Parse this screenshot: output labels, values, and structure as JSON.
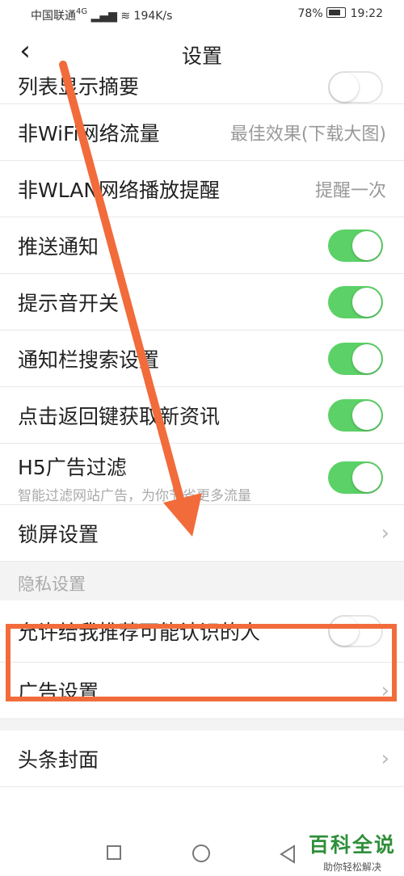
{
  "status_bar": {
    "carrier": "中国联通",
    "signal_type": "4G",
    "speed": "194K/s",
    "battery": "78%",
    "time": "19:22"
  },
  "header": {
    "back_icon": "chevron-left-icon",
    "title": "设置"
  },
  "settings": [
    {
      "label": "列表显示摘要",
      "type": "toggle",
      "on": false
    },
    {
      "label": "非WiFi网络流量",
      "type": "value",
      "value": "最佳效果(下载大图)"
    },
    {
      "label": "非WLAN网络播放提醒",
      "type": "value",
      "value": "提醒一次"
    },
    {
      "label": "推送通知",
      "type": "toggle",
      "on": true
    },
    {
      "label": "提示音开关",
      "type": "toggle",
      "on": true
    },
    {
      "label": "通知栏搜索设置",
      "type": "toggle",
      "on": true
    },
    {
      "label": "点击返回键获取新资讯",
      "type": "toggle",
      "on": true
    },
    {
      "label": "H5广告过滤",
      "sub": "智能过滤网站广告，为你节省更多流量",
      "type": "toggle",
      "on": true
    },
    {
      "label": "锁屏设置",
      "type": "link"
    }
  ],
  "privacy": {
    "section_label": "隐私设置",
    "items": [
      {
        "label": "允许给我推荐可能认识的人",
        "type": "toggle",
        "on": false
      },
      {
        "label": "广告设置",
        "type": "link"
      }
    ]
  },
  "more": [
    {
      "label": "头条封面",
      "type": "link"
    }
  ],
  "watermark": {
    "title": "百科全说",
    "subtitle": "助你轻松解决"
  },
  "colors": {
    "toggle_on": "#5cd167",
    "annotation": "#f26b3a",
    "watermark": "#2f8f3a"
  }
}
